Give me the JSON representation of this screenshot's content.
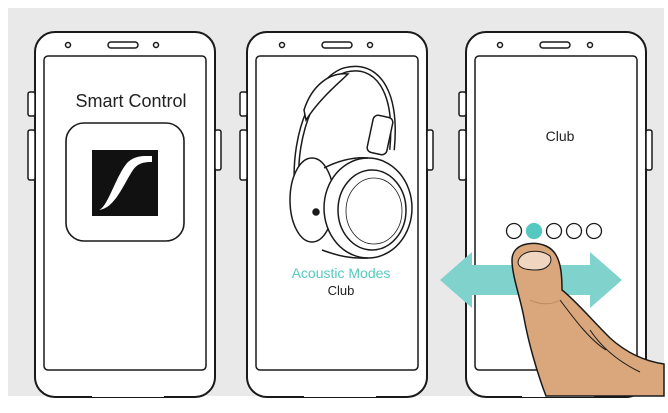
{
  "colors": {
    "background": "#e9e9e9",
    "phone_outline": "#1a1a1a",
    "accent": "#56c8c0",
    "arrow": "#7fd3cc",
    "skin": "#d9a77b",
    "skin_shadow": "#c08a5e",
    "nail": "#f0d6c0"
  },
  "phones": [
    {
      "title": "Smart Control",
      "icon": "sennheiser-logo-icon"
    },
    {
      "heading": "Acoustic Modes",
      "subtitle": "Club",
      "icon": "headphones-icon"
    },
    {
      "title": "Club",
      "carousel": {
        "dots": 5,
        "selected_index": 1
      },
      "icons": [
        "swipe-left-arrow-icon",
        "swipe-right-arrow-icon",
        "finger-icon"
      ]
    }
  ]
}
